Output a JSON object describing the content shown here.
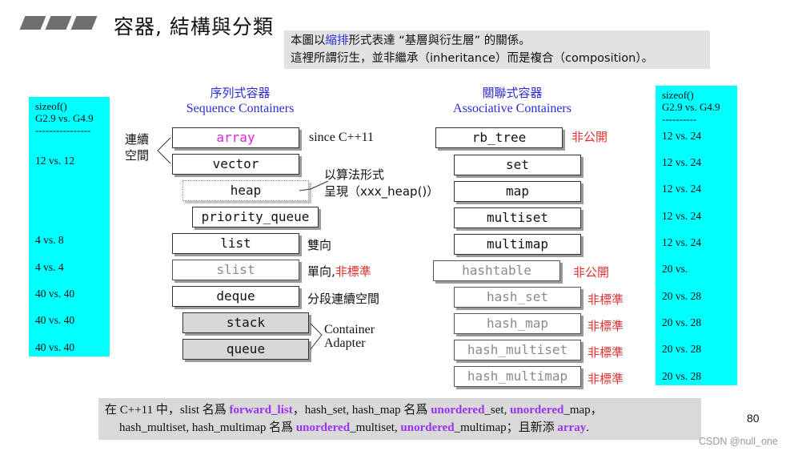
{
  "title": "容器, 結構與分類",
  "note": {
    "line1_pre": "本圖以",
    "line1_highlight": "縮排",
    "line1_post": "形式表達 “基層與衍生層” 的關係。",
    "line2": "這裡所謂衍生，並非繼承（inheritance）而是複合（composition）。"
  },
  "left_sizeof": {
    "header_line1": "sizeof()",
    "header_line2": "G2.9 vs. G4.9",
    "separator": "----------------",
    "rows": [
      "12 vs. 12",
      "4   vs. 8",
      "4   vs. 4",
      "40 vs. 40",
      "40 vs. 40",
      "40 vs. 40"
    ]
  },
  "sequence": {
    "title_cn": "序列式容器",
    "title_en": "Sequence Containers",
    "contiguous_label_1": "連續",
    "contiguous_label_2": "空間",
    "boxes": [
      "array",
      "vector",
      "heap",
      "priority_queue",
      "list",
      "slist",
      "deque",
      "stack",
      "queue"
    ],
    "notes": {
      "array": "since C++11",
      "heap_1": "以算法形式",
      "heap_2": "呈現（xxx_heap()）",
      "list": "雙向",
      "slist_pre": "單向,",
      "slist_red": "非標準",
      "deque": "分段連續空間",
      "adapter_1": "Container",
      "adapter_2": "Adapter"
    }
  },
  "associative": {
    "title_cn": "關聯式容器",
    "title_en": "Associative Containers",
    "boxes": [
      "rb_tree",
      "set",
      "map",
      "multiset",
      "multimap",
      "hashtable",
      "hash_set",
      "hash_map",
      "hash_multiset",
      "hash_multimap"
    ],
    "notes": {
      "rb_tree": "非公開",
      "hashtable": "非公開",
      "hash_set": "非標準",
      "hash_map": "非標準",
      "hash_multiset": "非標準",
      "hash_multimap": "非標準"
    }
  },
  "right_sizeof": {
    "header_line1": "sizeof()",
    "header_line2": "G2.9 vs. G4.9",
    "separator": "----------",
    "rows": [
      "12 vs. 24",
      "12 vs. 24",
      "12 vs. 24",
      "12 vs. 24",
      "12 vs. 24",
      "20 vs.",
      "20 vs. 28",
      "20 vs. 28",
      "20 vs. 28",
      "20 vs. 28"
    ]
  },
  "bottom": {
    "l1_a": "在 C++11 中，slist 名爲 ",
    "l1_b": "forward_list",
    "l1_c": "，hash_set, hash_map 名爲 ",
    "l1_d": "unordered",
    "l1_e": "_set, ",
    "l1_f": "unordered",
    "l1_g": "_map，",
    "l2_a": "hash_multiset, hash_multimap 名爲 ",
    "l2_b": "unordered",
    "l2_c": "_multiset, ",
    "l2_d": "unordered",
    "l2_e": "_multimap；且新添 ",
    "l2_f": "array",
    "l2_g": "."
  },
  "page_number": "80",
  "watermark_credit": "CSDN @null_one",
  "colors": {
    "cyan": "#00ffff",
    "blue_heading": "#2b2bd0",
    "red_note": "#e03030",
    "purple": "#9933ee",
    "array_magenta": "#dd22dd"
  }
}
